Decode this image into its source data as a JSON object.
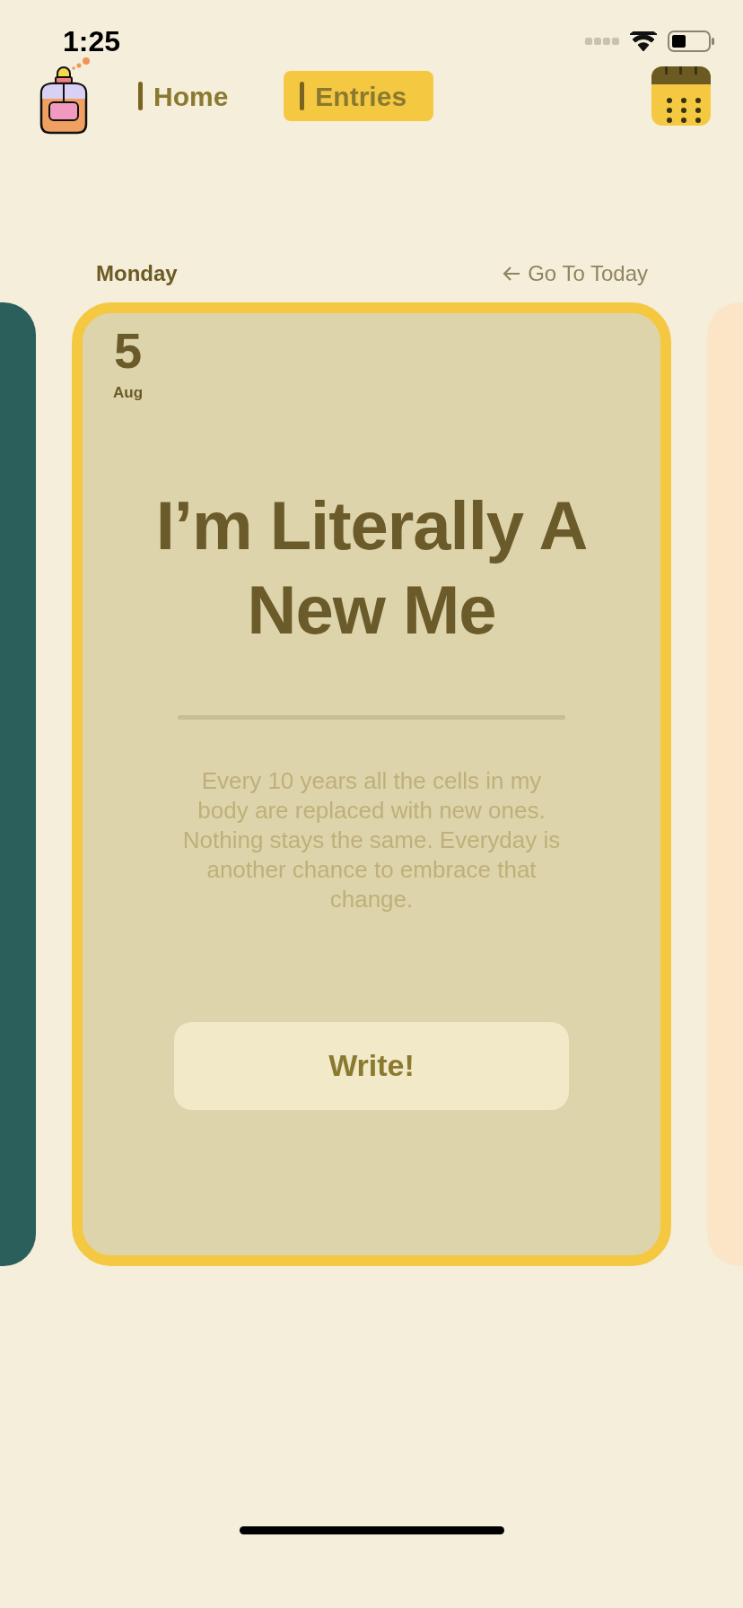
{
  "status_bar": {
    "time": "1:25"
  },
  "nav": {
    "tabs": [
      {
        "label": "Home",
        "selected": false
      },
      {
        "label": "Entries",
        "selected": true
      }
    ]
  },
  "day_header": {
    "weekday": "Monday",
    "go_to_today": "Go To Today"
  },
  "entry_card": {
    "day": "5",
    "month": "Aug",
    "title": "I’m Literally A New Me",
    "prompt": "Every 10 years all the cells in my body are replaced with new ones. Nothing stays the same. Everyday is another chance to embrace that change.",
    "button": "Write!"
  }
}
